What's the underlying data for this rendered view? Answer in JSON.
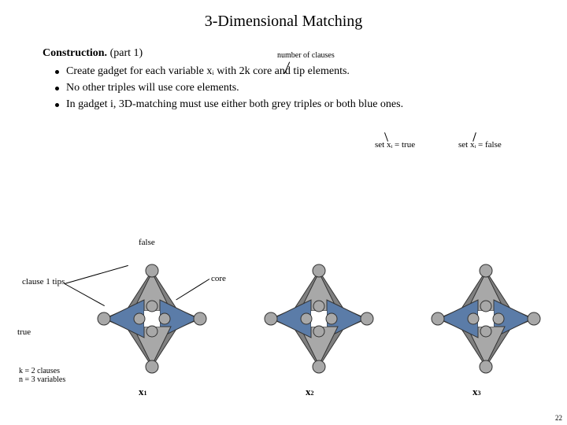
{
  "title": "3-Dimensional Matching",
  "lead": "Construction.",
  "lead_tail": " (part 1)",
  "bullets": [
    "Create gadget for each variable xᵢ with 2k core and tip elements.",
    "No other triples will use core elements.",
    "In gadget i, 3D-matching must use either both grey triples or both blue ones."
  ],
  "annotations": {
    "number_of_clauses": "number of clauses",
    "set_true": "set xᵢ = true",
    "set_false": "set xᵢ = false",
    "label_false": "false",
    "label_true": "true",
    "clause1_tips": "clause 1 tips",
    "core": "core",
    "kn": "k = 2 clauses\nn = 3 variables"
  },
  "gadget_labels": [
    "x",
    "x",
    "x"
  ],
  "gadget_subs": [
    "1",
    "2",
    "3"
  ],
  "page_number": "22",
  "chart_data": {
    "type": "diagram",
    "description": "Three identical variable gadgets x1,x2,x3. Each gadget is a 4-pointed star with outer tip circles (grey), 4 inner core circles (grey) around a white square, alternating grey and blue triangles connecting tips to cores.",
    "gadgets": 3,
    "k_clauses": 2,
    "n_variables": 3,
    "triangle_colors": [
      "grey",
      "blue"
    ],
    "core_count_per_gadget": 4,
    "tip_count_per_gadget": 4,
    "annotations": {
      "top_tip": "false",
      "left_tip": "true",
      "clause1_tips_arrows_to": "left and top outer tip circles of x1",
      "core_arrow_to": "inner core circle of x1",
      "number_of_clauses_arrow_to": "2k in bullet text",
      "set_true_arrow_to": "grey triples",
      "set_false_arrow_to": "blue triples"
    }
  }
}
